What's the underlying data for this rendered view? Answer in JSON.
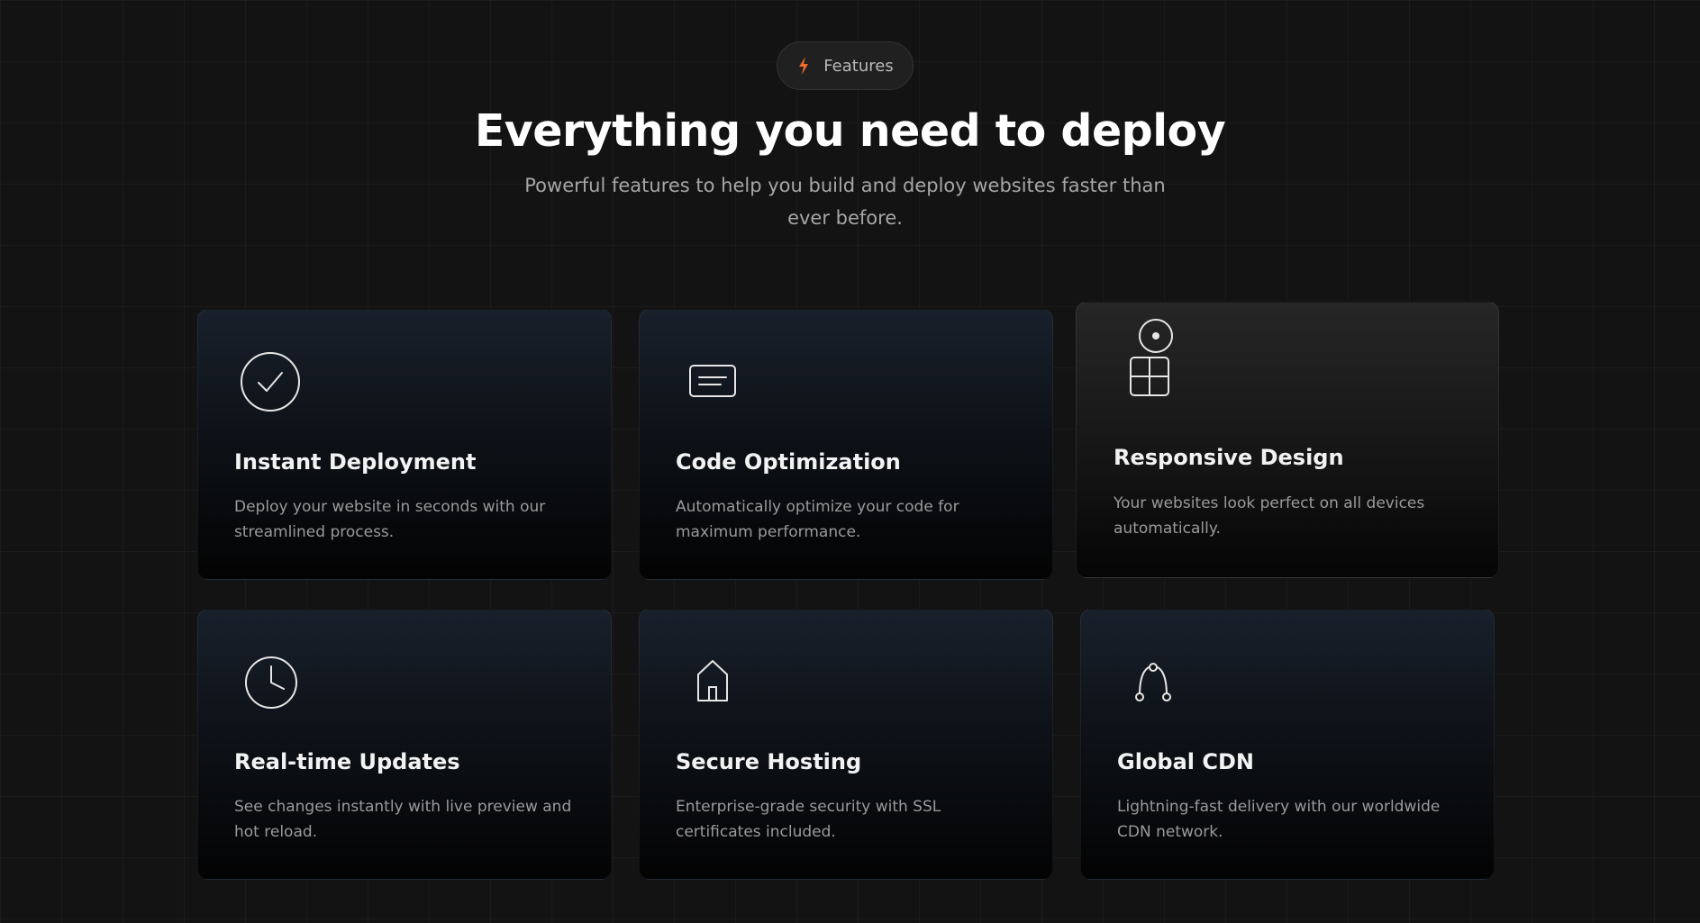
{
  "header": {
    "badge_label": "Features",
    "badge_icon": "lightning-icon",
    "accent_color": "#f26b2a",
    "title": "Everything you need to deploy",
    "subtitle": "Powerful features to help you build and deploy websites faster than ever before."
  },
  "features": [
    {
      "icon": "check-circle-icon",
      "title": "Instant Deployment",
      "description": "Deploy your website in seconds with our streamlined process."
    },
    {
      "icon": "code-window-icon",
      "title": "Code Optimization",
      "description": "Automatically optimize your code for maximum performance."
    },
    {
      "icon": "devices-grid-icon",
      "title": "Responsive Design",
      "description": "Your websites look perfect on all devices automatically."
    },
    {
      "icon": "clock-icon",
      "title": "Real-time Updates",
      "description": "See changes instantly with live preview and hot reload."
    },
    {
      "icon": "house-icon",
      "title": "Secure Hosting",
      "description": "Enterprise-grade security with SSL certificates included."
    },
    {
      "icon": "network-arc-icon",
      "title": "Global CDN",
      "description": "Lightning-fast delivery with our worldwide CDN network."
    }
  ]
}
